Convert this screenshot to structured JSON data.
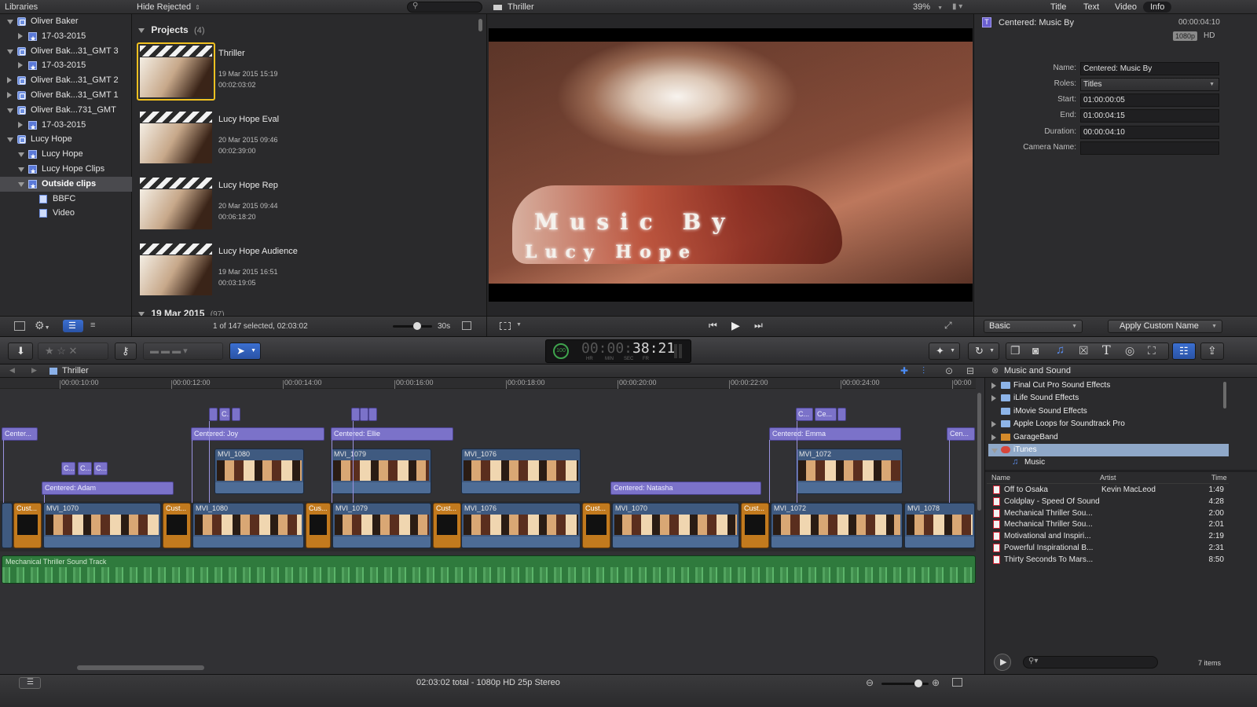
{
  "libraries": {
    "header": "Libraries",
    "items": [
      {
        "label": "Oliver Baker",
        "type": "library",
        "expanded": true
      },
      {
        "label": "17-03-2015",
        "type": "event",
        "expanded": false
      },
      {
        "label": "Oliver Bak...31_GMT 3",
        "type": "library",
        "expanded": true
      },
      {
        "label": "17-03-2015",
        "type": "event",
        "expanded": false
      },
      {
        "label": "Oliver Bak...31_GMT 2",
        "type": "library",
        "expanded": false
      },
      {
        "label": "Oliver Bak...31_GMT 1",
        "type": "library",
        "expanded": false
      },
      {
        "label": "Oliver Bak...731_GMT",
        "type": "library",
        "expanded": true
      },
      {
        "label": "17-03-2015",
        "type": "event",
        "expanded": false
      },
      {
        "label": "Lucy Hope",
        "type": "library",
        "expanded": true
      },
      {
        "label": "Lucy Hope",
        "type": "event",
        "expanded": true
      },
      {
        "label": "Lucy Hope Clips",
        "type": "event",
        "expanded": true
      },
      {
        "label": "Outside clips",
        "type": "event",
        "expanded": true,
        "selected": true
      },
      {
        "label": "BBFC",
        "type": "keyword"
      },
      {
        "label": "Video",
        "type": "keyword"
      }
    ]
  },
  "browser": {
    "filter": "Hide Rejected",
    "group_label": "Projects",
    "group_count": "(4)",
    "projects": [
      {
        "name": "Thriller",
        "date": "19 Mar 2015 15:19",
        "duration": "00:02:03:02",
        "selected": true
      },
      {
        "name": "Lucy Hope Eval",
        "date": "20 Mar 2015 09:46",
        "duration": "00:02:39:00"
      },
      {
        "name": "Lucy Hope Rep",
        "date": "20 Mar 2015 09:44",
        "duration": "00:06:18:20"
      },
      {
        "name": "Lucy Hope Audience",
        "date": "19 Mar 2015 16:51",
        "duration": "00:03:19:05"
      }
    ],
    "next_group": "19 Mar 2015",
    "next_group_count": "(97)",
    "status": "1 of 147 selected, 02:03:02",
    "clip_duration": "30s"
  },
  "viewer": {
    "title": "Thriller",
    "zoom": "39%",
    "overlay_line1": "Music By",
    "overlay_line2": "Lucy Hope"
  },
  "inspector": {
    "tabs": [
      "Title",
      "Text",
      "Video",
      "Info"
    ],
    "active_tab": "Info",
    "clip_name": "Centered: Music By",
    "clip_time": "00:00:04:10",
    "badge_res": "1080p",
    "badge_hd": "HD",
    "fields": [
      {
        "label": "Name:",
        "value": "Centered: Music By"
      },
      {
        "label": "Roles:",
        "value": "Titles"
      },
      {
        "label": "Start:",
        "value": "01:00:00:05"
      },
      {
        "label": "End:",
        "value": "01:00:04:15"
      },
      {
        "label": "Duration:",
        "value": "00:00:04:10"
      },
      {
        "label": "Camera Name:",
        "value": ""
      }
    ],
    "metadata_view": "Basic",
    "apply_button": "Apply Custom Name"
  },
  "toolbar": {
    "timecode": "00:00:38:21",
    "timecode_dim": "00:00:",
    "timecode_bright": "38:21",
    "timecode_units": [
      "HR",
      "MIN",
      "SEC",
      "FR"
    ],
    "progress_badge": "100"
  },
  "timeline": {
    "project": "Thriller",
    "ruler": [
      "00:00:10:00",
      "00:00:12:00",
      "00:00:14:00",
      "00:00:16:00",
      "00:00:18:00",
      "00:00:20:00",
      "00:00:22:00",
      "00:00:24:00",
      "00:00"
    ],
    "titles": [
      "Center...",
      "Centered: Joy",
      "Centered: Ellie",
      "Centered: Adam",
      "Centered: Natasha",
      "Centered: Emma",
      "Cen..."
    ],
    "small_titles": [
      "C...",
      "C...",
      "C...",
      "C...",
      "C...",
      "Ce..."
    ],
    "connected_clips": [
      "MVI_1080",
      "MVI_1079",
      "MVI_1076",
      "MVI_1072"
    ],
    "primary_clips": [
      "MVI_1070",
      "MVI_1080",
      "MVI_1079",
      "MVI_1076",
      "MVI_1070",
      "MVI_1072",
      "MVI_1078"
    ],
    "gaps": [
      "Cust...",
      "Cust...",
      "Cus...",
      "Cust...",
      "Cust...",
      "Cust..."
    ],
    "audio": "Mechanical Thriller Sound Track",
    "status": "02:03:02 total - 1080p HD 25p Stereo"
  },
  "media_browser": {
    "header": "Music and Sound",
    "sources": [
      {
        "label": "Final Cut Pro Sound Effects",
        "expandable": true
      },
      {
        "label": "iLife Sound Effects",
        "expandable": true
      },
      {
        "label": "iMovie Sound Effects",
        "expandable": false
      },
      {
        "label": "Apple Loops for Soundtrack Pro",
        "expandable": true
      },
      {
        "label": "GarageBand",
        "expandable": true
      },
      {
        "label": "iTunes",
        "expandable": true,
        "selected": true
      },
      {
        "label": "Music",
        "expandable": false
      }
    ],
    "columns": [
      "Name",
      "Artist",
      "Time"
    ],
    "tracks": [
      {
        "name": "Off to Osaka",
        "artist": "Kevin MacLeod",
        "time": "1:49"
      },
      {
        "name": "Coldplay - Speed Of Sound",
        "artist": "",
        "time": "4:28"
      },
      {
        "name": "Mechanical Thriller Sou...",
        "artist": "",
        "time": "2:00"
      },
      {
        "name": "Mechanical Thriller Sou...",
        "artist": "",
        "time": "2:01"
      },
      {
        "name": "Motivational and Inspiri...",
        "artist": "",
        "time": "2:19"
      },
      {
        "name": "Powerful Inspirational B...",
        "artist": "",
        "time": "2:31"
      },
      {
        "name": "Thirty Seconds To Mars...",
        "artist": "",
        "time": "8:50"
      }
    ],
    "item_count": "7 items"
  },
  "colors": {
    "selection": "#3d6fd6",
    "title_clip": "#7b72c9",
    "video_clip": "#3f5a80",
    "gap_clip": "#c27a1e",
    "audio_clip": "#2f7a3d",
    "project_highlight": "#f0c020"
  }
}
